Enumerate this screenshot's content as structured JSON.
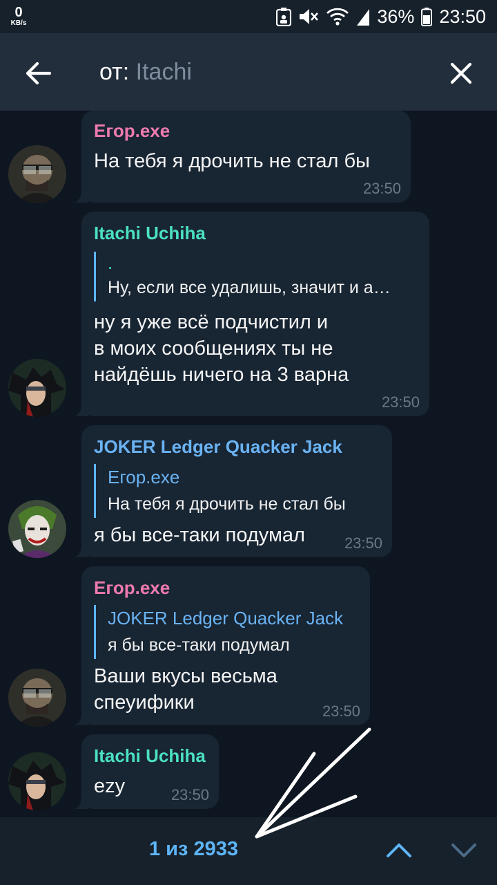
{
  "status_bar": {
    "net_speed_value": "0",
    "net_speed_unit": "KB/s",
    "battery_percent": "36%",
    "time": "23:50",
    "icons": [
      "vpn-lock-icon",
      "mute-icon",
      "wifi-icon",
      "signal-icon",
      "battery-icon"
    ]
  },
  "header": {
    "search_prefix": "от: ",
    "search_value": "Itachi",
    "back_icon": "arrow-left-icon",
    "close_icon": "close-icon"
  },
  "messages": [
    {
      "sender": "Егор.exe",
      "sender_color": "#ee7aae",
      "text_lines": [
        "На тебя я дрочить не стал бы"
      ],
      "time": "23:50",
      "avatar": "egor-avatar"
    },
    {
      "sender": "Itachi Uchiha",
      "sender_color": "#4be1c3",
      "reply": {
        "name": ".",
        "text": "Ну, если все удалишь, значит и а…"
      },
      "text_lines": [
        "ну я уже всё подчистил и",
        "в моих сообщениях ты не",
        "найдёшь ничего на 3 варна"
      ],
      "time": "23:50",
      "avatar": "itachi-avatar"
    },
    {
      "sender": "JOKER Ledger Quacker Jack",
      "sender_color": "#6ab3f3",
      "reply": {
        "name": "Егор.exe",
        "text": "На тебя я дрочить не стал бы"
      },
      "text_lines": [
        "я бы все-таки подумал"
      ],
      "time": "23:50",
      "avatar": "joker-avatar"
    },
    {
      "sender": "Егор.exe",
      "sender_color": "#ee7aae",
      "reply": {
        "name": "JOKER Ledger Quacker Jack",
        "text": "я бы все-таки подумал"
      },
      "text_lines": [
        "Ваши вкусы весьма",
        "спеуифики"
      ],
      "time": "23:50",
      "avatar": "egor-avatar"
    },
    {
      "sender": "Itachi Uchiha",
      "sender_color": "#4be1c3",
      "text_lines": [
        "ezy"
      ],
      "time": "23:50",
      "avatar": "itachi-avatar"
    }
  ],
  "bottom_bar": {
    "counter": "1 из 2933",
    "up_icon": "chevron-up-icon",
    "down_icon": "chevron-down-icon"
  },
  "colors": {
    "background": "#0e1621",
    "header": "#232e3c",
    "bubble": "#182533",
    "accent": "#5eb5f7",
    "time": "#6c7883"
  }
}
